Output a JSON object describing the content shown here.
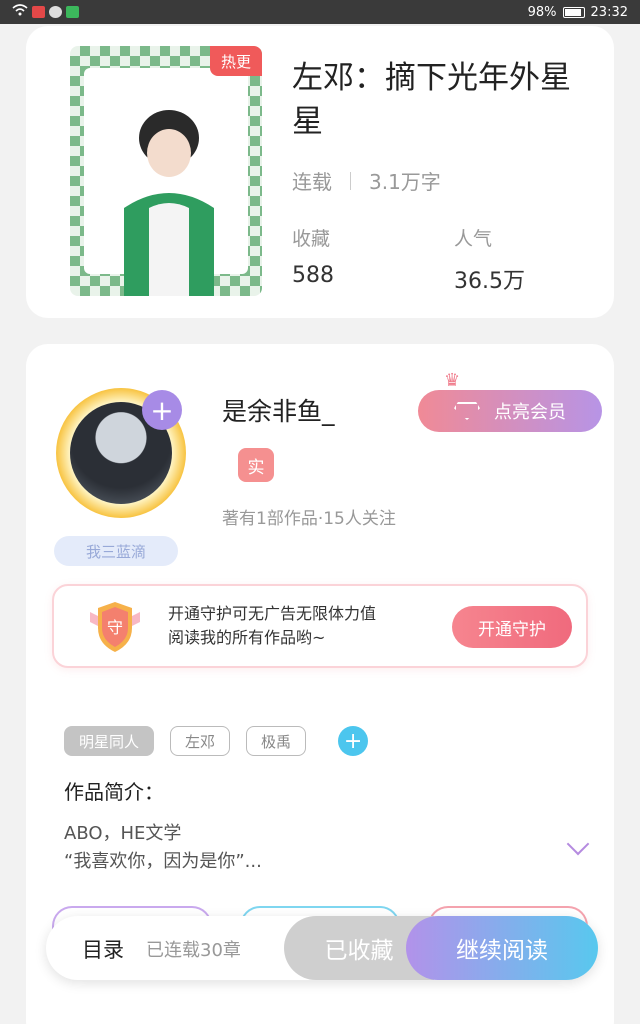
{
  "status_bar": {
    "battery": "98%",
    "time": "23:32"
  },
  "book": {
    "hot_badge": "热更",
    "title": "左邓：摘下光年外星星",
    "status": "连载",
    "word_count": "3.1万字",
    "favorites_label": "收藏",
    "favorites_value": "588",
    "popularity_label": "人气",
    "popularity_value": "36.5万"
  },
  "author": {
    "name": "是余非鱼_",
    "real_badge": "实",
    "stats": "著有1部作品·15人关注",
    "tag_pill": "我三蓝滴",
    "vip_button": "点亮会员"
  },
  "guard": {
    "icon_text": "守",
    "line1": "开通守护可无广告无限体力值",
    "line2": "阅读我的所有作品哟~",
    "button": "开通守护"
  },
  "tags": [
    "明星同人",
    "左邓",
    "极禹"
  ],
  "intro": {
    "title": "作品简介：",
    "line1": "ABO，HE文学",
    "line2": "“我喜欢你，因为是你”..."
  },
  "bottom_bar": {
    "catalog": "目录",
    "serial": "已连载30章",
    "favorited": "已收藏",
    "continue": "继续阅读"
  },
  "colors": {
    "accent_red": "#f05a5a",
    "purple": "#a78be6",
    "cyan": "#4cc6ee"
  }
}
